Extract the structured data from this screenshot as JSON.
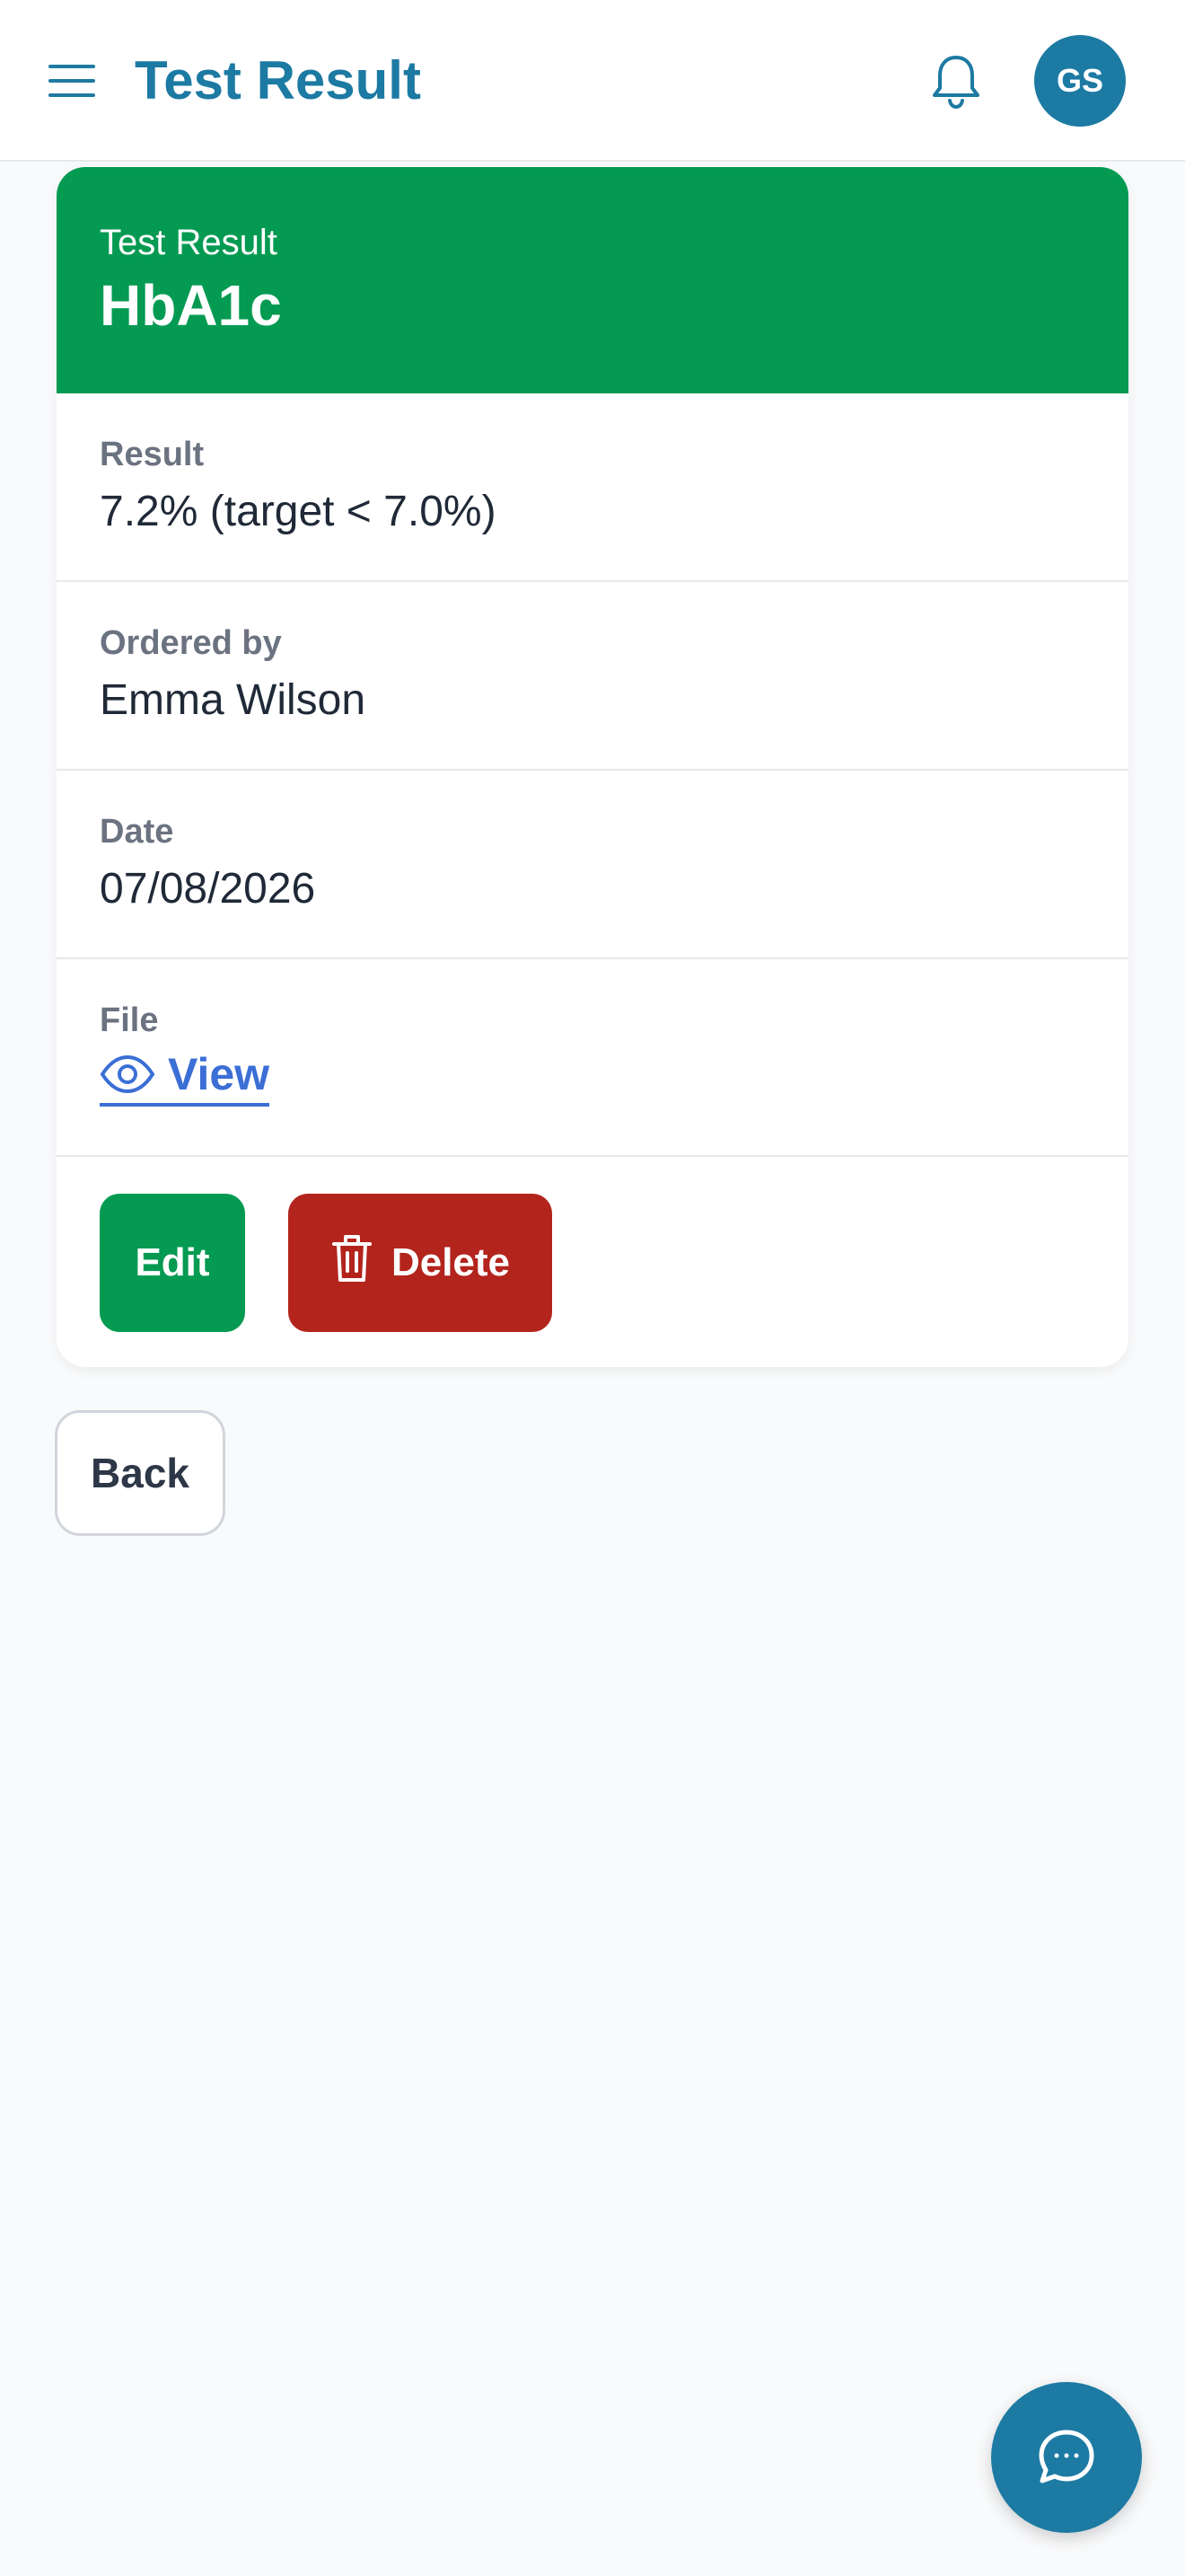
{
  "header": {
    "title": "Test Result",
    "avatar_initials": "GS",
    "icons": {
      "menu": "menu-icon",
      "notifications": "bell-icon"
    }
  },
  "card": {
    "eyebrow": "Test Result",
    "heading": "HbA1c",
    "header_color": "#049a52",
    "fields": [
      {
        "label": "Result",
        "value": "7.2% (target < 7.0%)"
      },
      {
        "label": "Ordered by",
        "value": "Emma Wilson"
      },
      {
        "label": "Date",
        "value": "07/08/2026"
      },
      {
        "label": "File",
        "link_label": "View",
        "link_icon": "eye-icon"
      }
    ],
    "actions": {
      "edit_label": "Edit",
      "delete_label": "Delete",
      "delete_icon": "trash-icon",
      "edit_color": "#049a52",
      "delete_color": "#b3241d"
    }
  },
  "back_label": "Back",
  "chat": {
    "icon": "chat-bubble-icon",
    "color": "#1c7aa3"
  },
  "colors": {
    "brand": "#1c7aa3",
    "link": "#3b6fd6",
    "background": "#f9fafb"
  }
}
